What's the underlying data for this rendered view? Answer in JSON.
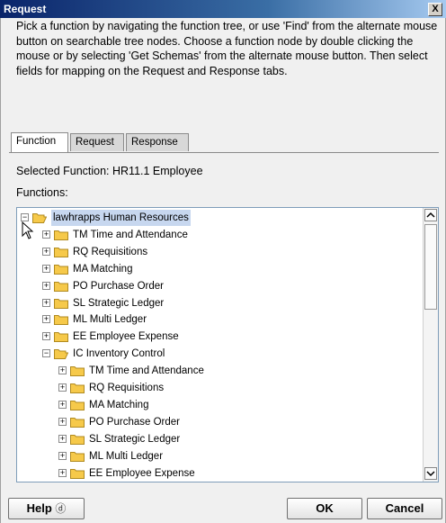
{
  "window": {
    "title": "Request",
    "close_label": "X"
  },
  "instructions": "Pick a function by navigating the function tree, or use 'Find' from the alternate mouse button on searchable tree nodes. Choose a function node by double clicking the mouse or by selecting 'Get Schemas' from the alternate mouse button. Then select fields for mapping on the Request and Response tabs.",
  "tabs": [
    {
      "label": "Function",
      "active": true
    },
    {
      "label": "Request",
      "active": false
    },
    {
      "label": "Response",
      "active": false
    }
  ],
  "selected_function": "Selected Function: HR11.1  Employee",
  "functions_label": "Functions:",
  "tree": [
    {
      "label": "lawhrapps  Human Resources",
      "level": 0,
      "expanded": true,
      "selected": true
    },
    {
      "label": "TM  Time and Attendance",
      "level": 1,
      "expanded": false
    },
    {
      "label": "RQ  Requisitions",
      "level": 1,
      "expanded": false
    },
    {
      "label": "MA  Matching",
      "level": 1,
      "expanded": false
    },
    {
      "label": "PO  Purchase Order",
      "level": 1,
      "expanded": false
    },
    {
      "label": "SL  Strategic Ledger",
      "level": 1,
      "expanded": false
    },
    {
      "label": "ML  Multi Ledger",
      "level": 1,
      "expanded": false
    },
    {
      "label": "EE  Employee Expense",
      "level": 1,
      "expanded": false
    },
    {
      "label": "IC  Inventory Control",
      "level": 1,
      "expanded": true
    },
    {
      "label": "TM  Time and Attendance",
      "level": 2,
      "expanded": false
    },
    {
      "label": "RQ  Requisitions",
      "level": 2,
      "expanded": false
    },
    {
      "label": "MA  Matching",
      "level": 2,
      "expanded": false
    },
    {
      "label": "PO  Purchase Order",
      "level": 2,
      "expanded": false
    },
    {
      "label": "SL  Strategic Ledger",
      "level": 2,
      "expanded": false
    },
    {
      "label": "ML  Multi Ledger",
      "level": 2,
      "expanded": false
    },
    {
      "label": "EE  Employee Expense",
      "level": 2,
      "expanded": false
    }
  ],
  "buttons": {
    "help": "Help",
    "help_icon": "?",
    "ok": "OK",
    "cancel": "Cancel"
  },
  "colors": {
    "title_bar": "#0a246a",
    "folder": "#f6c94a",
    "selection": "#c7d7ef"
  }
}
